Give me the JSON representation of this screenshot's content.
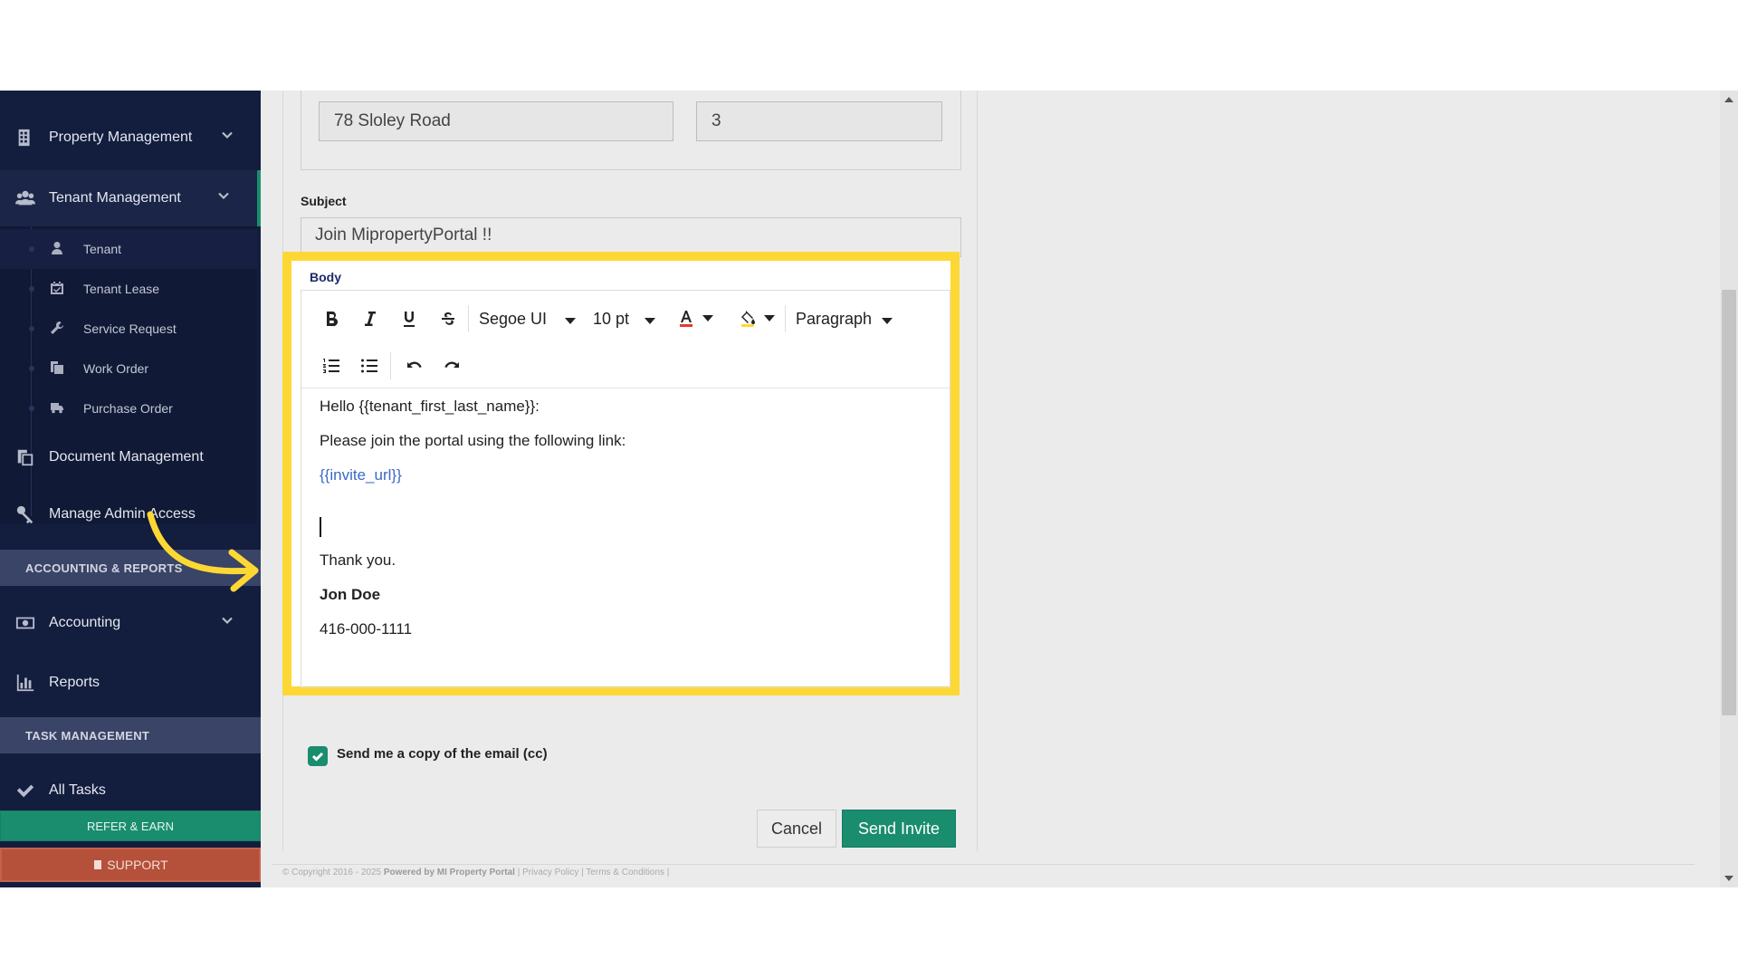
{
  "sidebar": {
    "items": [
      {
        "label": "Property Management",
        "icon": "building-icon"
      },
      {
        "label": "Tenant Management",
        "icon": "users-icon"
      },
      {
        "label": "Document Management",
        "icon": "documents-icon"
      },
      {
        "label": "Manage Admin Access",
        "icon": "key-icon"
      },
      {
        "label": "Accounting",
        "icon": "money-icon"
      },
      {
        "label": "Reports",
        "icon": "bar-chart-icon"
      },
      {
        "label": "All Tasks",
        "icon": "check-icon"
      }
    ],
    "sub_items": [
      {
        "label": "Tenant",
        "icon": "user-icon"
      },
      {
        "label": "Tenant Lease",
        "icon": "calendar-check-icon"
      },
      {
        "label": "Service Request",
        "icon": "wrench-icon"
      },
      {
        "label": "Work Order",
        "icon": "copy-icon"
      },
      {
        "label": "Purchase Order",
        "icon": "truck-icon"
      }
    ],
    "sections": [
      "ACCOUNTING & REPORTS",
      "TASK MANAGEMENT"
    ],
    "refer_label": "REFER & EARN",
    "support_label": "SUPPORT"
  },
  "form": {
    "property_value": "78  Sloley Road",
    "unit_value": "3",
    "subject_label": "Subject",
    "subject_value": "Join MipropertyPortal !!",
    "body_label": "Body"
  },
  "toolbar": {
    "font_family": "Segoe UI",
    "font_size": "10 pt",
    "block_format": "Paragraph"
  },
  "body": {
    "greeting": "Hello {{tenant_first_last_name}}:",
    "instruction": "Please join the portal using the following link:",
    "link": "{{invite_url}}",
    "thanks": "Thank you.",
    "sig_name": "Jon Doe",
    "sig_phone": "416-000-1111"
  },
  "actions": {
    "cc_label": "Send me a copy of the email (cc)",
    "cancel_label": "Cancel",
    "send_label": "Send Invite"
  },
  "footer": {
    "copyright": "© Copyright 2016 - 2025",
    "powered": "Powered by MI Property Portal",
    "links": "| Privacy Policy | Terms & Conditions |"
  },
  "colors": {
    "sidebar_bg": "#131d3e",
    "accent_green": "#1a8d6e",
    "highlight_yellow": "#fdd835",
    "support_red": "#b5503a",
    "link_blue": "#3a68c7"
  }
}
